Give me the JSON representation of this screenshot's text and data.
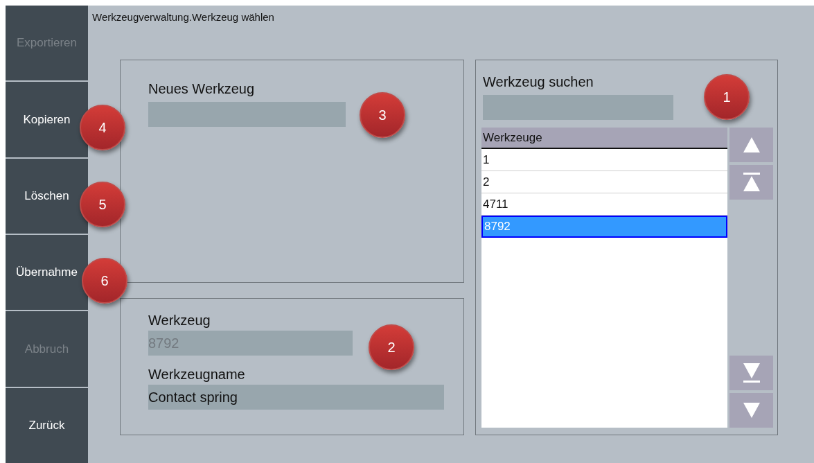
{
  "sidebar": {
    "buttons": [
      {
        "label": "Exportieren",
        "disabled": true
      },
      {
        "label": "Kopieren",
        "disabled": false
      },
      {
        "label": "Löschen",
        "disabled": false
      },
      {
        "label": "Übernahme",
        "disabled": false
      },
      {
        "label": "Abbruch",
        "disabled": true
      },
      {
        "label": "Zurück",
        "disabled": false
      }
    ]
  },
  "title": "Werkzeugverwaltung.Werkzeug wählen",
  "new_tool": {
    "label": "Neues Werkzeug"
  },
  "details": {
    "fields": [
      {
        "label": "Werkzeug",
        "value": "8792",
        "disabled": true
      },
      {
        "label": "Werkzeugname",
        "value": "Contact spring",
        "disabled": false
      }
    ]
  },
  "search": {
    "label": "Werkzeug suchen"
  },
  "tool_list": {
    "column": "Werkzeuge",
    "rows": [
      {
        "text": "1",
        "selected": false
      },
      {
        "text": "2",
        "selected": false
      },
      {
        "text": "4711",
        "selected": false
      },
      {
        "text": "8792",
        "selected": true
      }
    ],
    "scroll_buttons": [
      {
        "kind": "up"
      },
      {
        "kind": "top"
      },
      {
        "kind": "bottom"
      },
      {
        "kind": "down"
      }
    ]
  },
  "callouts": [
    "1",
    "4",
    "3",
    "5",
    "6",
    "2"
  ]
}
